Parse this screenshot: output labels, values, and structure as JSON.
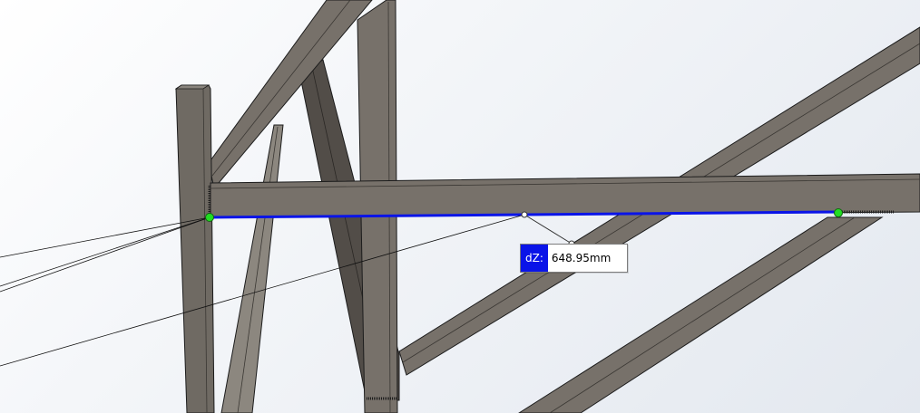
{
  "measurement": {
    "axis_label": "dZ:",
    "value": "648.95mm"
  },
  "colors": {
    "background_light": "#ffffff",
    "background_dark": "#e3e8ef",
    "steel_face": "#77716a",
    "steel_shadow": "#4f4a45",
    "steel_edge": "#1c1c1c",
    "measured_edge": "#0a14e8",
    "endpoint_marker": "#22dd22",
    "badge": "#0a14e8"
  }
}
